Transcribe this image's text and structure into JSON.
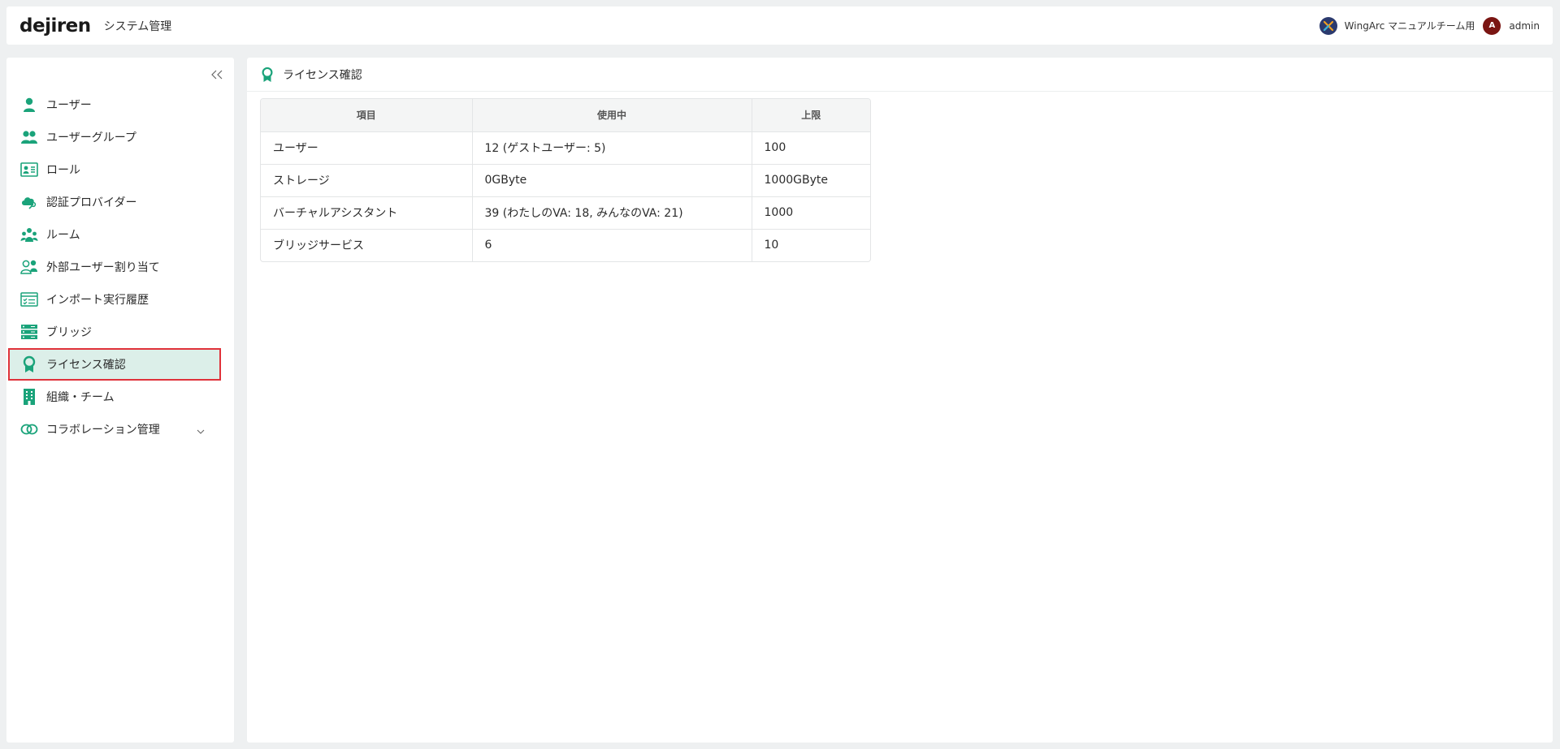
{
  "header": {
    "logo": "dejiren",
    "system_title": "システム管理",
    "org_name": "WingArc マニュアルチーム用",
    "avatar_letter": "A",
    "user_name": "admin"
  },
  "sidebar": {
    "items": [
      {
        "label": "ユーザー",
        "icon": "user-icon"
      },
      {
        "label": "ユーザーグループ",
        "icon": "user-group-icon"
      },
      {
        "label": "ロール",
        "icon": "role-card-icon"
      },
      {
        "label": "認証プロバイダー",
        "icon": "auth-provider-icon"
      },
      {
        "label": "ルーム",
        "icon": "room-icon"
      },
      {
        "label": "外部ユーザー割り当て",
        "icon": "external-user-icon"
      },
      {
        "label": "インポート実行履歴",
        "icon": "import-history-icon"
      },
      {
        "label": "ブリッジ",
        "icon": "bridge-icon"
      },
      {
        "label": "ライセンス確認",
        "icon": "license-icon",
        "active": true
      },
      {
        "label": "組織・チーム",
        "icon": "organization-icon"
      },
      {
        "label": "コラボレーション管理",
        "icon": "collaboration-icon",
        "expandable": true
      }
    ]
  },
  "main": {
    "title": "ライセンス確認",
    "table": {
      "headers": [
        "項目",
        "使用中",
        "上限"
      ],
      "rows": [
        [
          "ユーザー",
          "12 (ゲストユーザー: 5)",
          "100"
        ],
        [
          "ストレージ",
          "0GByte",
          "1000GByte"
        ],
        [
          "バーチャルアシスタント",
          "39 (わたしのVA: 18, みんなのVA: 21)",
          "1000"
        ],
        [
          "ブリッジサービス",
          "6",
          "10"
        ]
      ]
    }
  },
  "colors": {
    "accent": "#1aa37a",
    "active_bg": "#dcefe9",
    "highlight_border": "#e0323a"
  }
}
